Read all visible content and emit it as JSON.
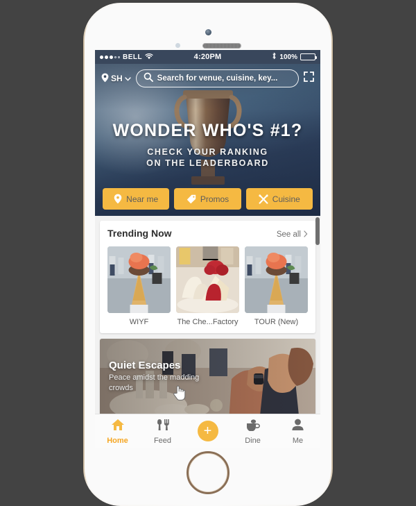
{
  "device": {
    "name": "iphone-mockup",
    "frame_color": "#e3d6c2",
    "background_color": "#434343"
  },
  "status_bar": {
    "carrier": "BELL",
    "signal_filled": 3,
    "signal_empty": 2,
    "wifi_icon": "wifi-icon",
    "time": "4:20PM",
    "bluetooth_icon": "bluetooth-icon",
    "battery_percent": "100%",
    "battery_icon": "battery-icon",
    "background_color": "#39475c"
  },
  "hero": {
    "location_label": "SH",
    "location_icon": "map-pin-icon",
    "chevron_icon": "chevron-down-icon",
    "search_icon": "search-icon",
    "search_placeholder": "Search for venue, cuisine, key...",
    "expand_icon": "expand-icon",
    "title": "WONDER WHO'S #1?",
    "subtitle_line1": "CHECK  YOUR RANKING",
    "subtitle_line2": "ON THE LEADERBOARD",
    "actions": [
      {
        "label": "Near me",
        "icon": "map-pin-icon"
      },
      {
        "label": "Promos",
        "icon": "tag-icon"
      },
      {
        "label": "Cuisine",
        "icon": "cutlery-icon"
      }
    ],
    "button_color": "#f5b942"
  },
  "trending": {
    "title": "Trending Now",
    "see_all_label": "See all",
    "see_all_icon": "chevron-right-icon",
    "items": [
      {
        "label": "WIYF",
        "image": "ice-cream-cone-photo"
      },
      {
        "label": "The Che...Factory",
        "image": "strawberry-cheesecake-photo"
      },
      {
        "label": "TOUR (New)",
        "image": "ice-cream-cone-photo"
      }
    ]
  },
  "feature_card": {
    "title": "Quiet Escapes",
    "subtitle": "Peace amidst the madding crowds",
    "image": "restaurant-diners-photo"
  },
  "tab_bar": {
    "active_color": "#f5a623",
    "inactive_color": "#6b6b6b",
    "items": [
      {
        "label": "Home",
        "icon": "home-icon",
        "active": true
      },
      {
        "label": "Feed",
        "icon": "cutlery-icon",
        "active": false
      },
      {
        "label": "Dine",
        "icon": "coffee-cup-icon",
        "active": false
      },
      {
        "label": "Me",
        "icon": "person-icon",
        "active": false
      }
    ],
    "add_button_label": "+",
    "add_button_icon": "plus-icon"
  },
  "cursor": {
    "type": "pointing-hand-cursor"
  }
}
